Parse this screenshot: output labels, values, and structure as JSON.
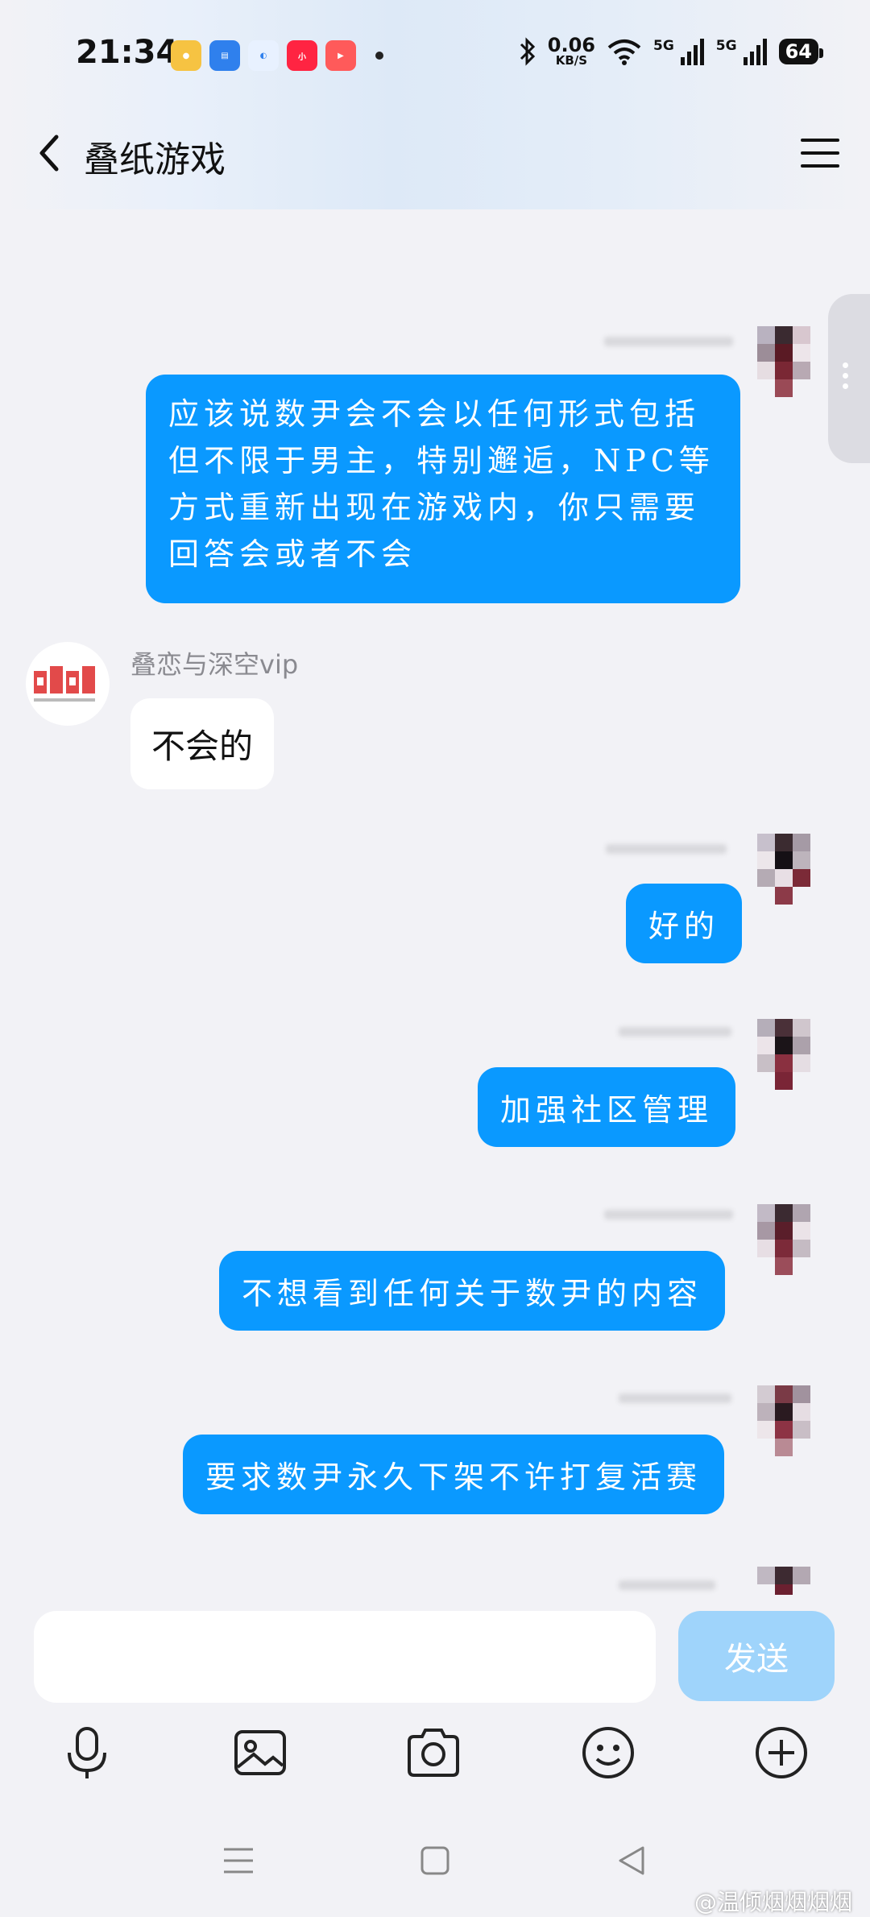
{
  "status_bar": {
    "time": "21:34",
    "net_speed_value": "0.06",
    "net_speed_unit": "KB/S",
    "net1": "5G",
    "net2": "5G",
    "battery": "64"
  },
  "header": {
    "title": "叠纸游戏"
  },
  "messages": [
    {
      "from": "me",
      "text": "应该说数尹会不会以任何形式包括但不限于男主，特别邂逅，NPC等方式重新出现在游戏内，你只需要回答会或者不会"
    },
    {
      "from": "other",
      "sender": "叠恋与深空vip",
      "text": "不会的"
    },
    {
      "from": "me",
      "text": "好的"
    },
    {
      "from": "me",
      "text": "加强社区管理"
    },
    {
      "from": "me",
      "text": "不想看到任何关于数尹的内容"
    },
    {
      "from": "me",
      "text": "要求数尹永久下架不许打复活赛"
    }
  ],
  "input": {
    "placeholder": "",
    "send_label": "发送"
  },
  "toolbar": [
    "microphone-icon",
    "image-icon",
    "camera-icon",
    "emoji-icon",
    "plus-icon"
  ],
  "watermark": "@温倾烟烟烟烟",
  "colors": {
    "outgoing_bubble": "#0a99ff",
    "incoming_bubble": "#ffffff",
    "send_button": "#9fd4fb",
    "background": "#f2f2f6"
  }
}
